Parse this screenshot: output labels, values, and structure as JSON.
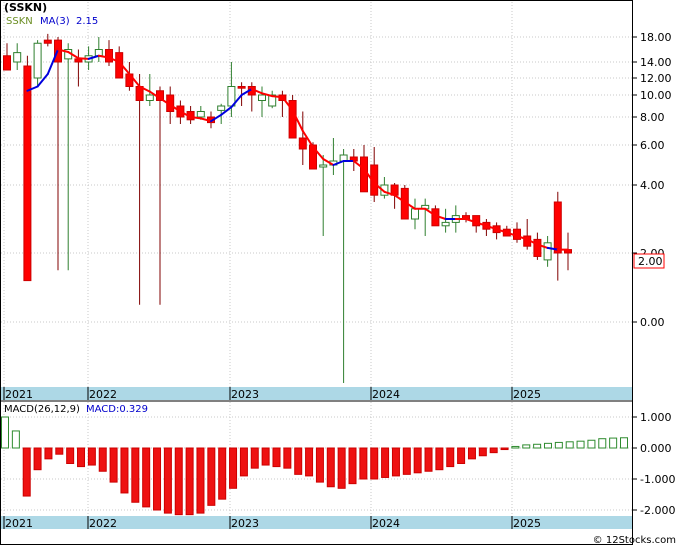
{
  "header": {
    "symbol": "(SSKN)",
    "ma_label": "MA(3)",
    "ma_value": "2.15",
    "last_price_tag": "2.00"
  },
  "macd_panel": {
    "label": "MACD(26,12,9)",
    "value_label": "MACD:0.329"
  },
  "watermark": "© 12Stocks.com",
  "colors": {
    "up_candle": "#3a9a3a",
    "down_candle": "#ff0000",
    "ma_up": "#0000dd",
    "ma_down": "#ff0000",
    "macd_up": "#2e8b2e",
    "macd_down": "#ee1111",
    "time_axis_band": "#add8e6",
    "price_tag": "#ff0000"
  },
  "chart_data": [
    {
      "type": "candlestick",
      "title": "(SSKN)",
      "y_scale": "custom-log",
      "y_ticks": [
        "18.00",
        "14.00",
        "12.00",
        "10.00",
        "8.00",
        "6.00",
        "4.00",
        "2.00",
        "0.00"
      ],
      "x_tick_labels": [
        "2021",
        "2022",
        "2023",
        "2024",
        "2025"
      ],
      "candles": [
        {
          "o": 15.0,
          "h": 17.0,
          "l": 13.5,
          "c": 13.0
        },
        {
          "o": 14.0,
          "h": 17.0,
          "l": 13.0,
          "c": 15.5
        },
        {
          "o": 13.5,
          "h": 15.0,
          "l": 1.2,
          "c": 1.2
        },
        {
          "o": 12.0,
          "h": 17.5,
          "l": 11.0,
          "c": 17.0
        },
        {
          "o": 17.5,
          "h": 18.5,
          "l": 16.5,
          "c": 17.0
        },
        {
          "o": 17.5,
          "h": 18.0,
          "l": 1.5,
          "c": 14.0
        },
        {
          "o": 14.5,
          "h": 17.0,
          "l": 1.5,
          "c": 16.0
        },
        {
          "o": 14.5,
          "h": 16.0,
          "l": 11.0,
          "c": 14.0
        },
        {
          "o": 14.0,
          "h": 16.5,
          "l": 13.0,
          "c": 15.0
        },
        {
          "o": 15.0,
          "h": 18.0,
          "l": 14.0,
          "c": 16.0
        },
        {
          "o": 16.0,
          "h": 17.5,
          "l": 13.5,
          "c": 14.0
        },
        {
          "o": 15.5,
          "h": 16.5,
          "l": 12.0,
          "c": 12.0
        },
        {
          "o": 12.5,
          "h": 14.0,
          "l": 10.5,
          "c": 11.0
        },
        {
          "o": 11.0,
          "h": 12.5,
          "l": 0.5,
          "c": 9.5
        },
        {
          "o": 9.5,
          "h": 12.5,
          "l": 9.0,
          "c": 10.0
        },
        {
          "o": 10.5,
          "h": 11.0,
          "l": 0.5,
          "c": 9.5
        },
        {
          "o": 10.0,
          "h": 11.0,
          "l": 7.5,
          "c": 8.5
        },
        {
          "o": 9.0,
          "h": 9.5,
          "l": 7.5,
          "c": 8.0
        },
        {
          "o": 8.5,
          "h": 9.0,
          "l": 7.5,
          "c": 7.8
        },
        {
          "o": 8.0,
          "h": 9.0,
          "l": 7.8,
          "c": 8.5
        },
        {
          "o": 8.0,
          "h": 8.5,
          "l": 7.2,
          "c": 7.6
        },
        {
          "o": 8.6,
          "h": 9.2,
          "l": 7.5,
          "c": 9.0
        },
        {
          "o": 9.0,
          "h": 14.0,
          "l": 8.0,
          "c": 11.0
        },
        {
          "o": 11.0,
          "h": 11.5,
          "l": 9.0,
          "c": 10.8
        },
        {
          "o": 11.0,
          "h": 11.5,
          "l": 8.5,
          "c": 10.0
        },
        {
          "o": 9.5,
          "h": 11.0,
          "l": 8.0,
          "c": 10.0
        },
        {
          "o": 9.0,
          "h": 10.5,
          "l": 8.8,
          "c": 10.0
        },
        {
          "o": 10.0,
          "h": 10.5,
          "l": 8.0,
          "c": 9.5
        },
        {
          "o": 9.5,
          "h": 10.0,
          "l": 6.5,
          "c": 6.5
        },
        {
          "o": 6.5,
          "h": 8.5,
          "l": 5.0,
          "c": 5.8
        },
        {
          "o": 6.0,
          "h": 6.2,
          "l": 4.8,
          "c": 4.8
        },
        {
          "o": 4.9,
          "h": 5.5,
          "l": 2.5,
          "c": 5.0
        },
        {
          "o": 5.0,
          "h": 6.5,
          "l": 4.5,
          "c": 5.2
        },
        {
          "o": 5.2,
          "h": 5.8,
          "l": -1.5,
          "c": 5.5
        },
        {
          "o": 5.4,
          "h": 5.8,
          "l": 4.7,
          "c": 5.2
        },
        {
          "o": 5.4,
          "h": 6.0,
          "l": 4.0,
          "c": 3.8
        },
        {
          "o": 5.0,
          "h": 5.9,
          "l": 3.5,
          "c": 3.7
        },
        {
          "o": 3.7,
          "h": 4.4,
          "l": 3.6,
          "c": 4.0
        },
        {
          "o": 4.0,
          "h": 4.1,
          "l": 3.3,
          "c": 3.7
        },
        {
          "o": 3.9,
          "h": 4.0,
          "l": 3.0,
          "c": 3.0
        },
        {
          "o": 3.0,
          "h": 3.6,
          "l": 2.7,
          "c": 3.3
        },
        {
          "o": 3.3,
          "h": 3.6,
          "l": 2.5,
          "c": 3.4
        },
        {
          "o": 3.3,
          "h": 3.4,
          "l": 2.8,
          "c": 2.8
        },
        {
          "o": 2.8,
          "h": 3.3,
          "l": 2.6,
          "c": 2.9
        },
        {
          "o": 2.9,
          "h": 3.4,
          "l": 2.6,
          "c": 3.1
        },
        {
          "o": 3.1,
          "h": 3.2,
          "l": 2.9,
          "c": 3.0
        },
        {
          "o": 3.1,
          "h": 3.1,
          "l": 2.6,
          "c": 2.8
        },
        {
          "o": 2.9,
          "h": 3.0,
          "l": 2.5,
          "c": 2.7
        },
        {
          "o": 2.8,
          "h": 2.9,
          "l": 2.4,
          "c": 2.6
        },
        {
          "o": 2.7,
          "h": 2.8,
          "l": 2.5,
          "c": 2.5
        },
        {
          "o": 2.7,
          "h": 2.9,
          "l": 2.3,
          "c": 2.4
        },
        {
          "o": 2.5,
          "h": 3.0,
          "l": 2.1,
          "c": 2.2
        },
        {
          "o": 2.4,
          "h": 2.6,
          "l": 1.8,
          "c": 1.9
        },
        {
          "o": 1.8,
          "h": 2.5,
          "l": 1.6,
          "c": 2.3
        },
        {
          "o": 3.5,
          "h": 3.8,
          "l": 1.2,
          "c": 2.0
        },
        {
          "o": 2.1,
          "h": 2.6,
          "l": 1.5,
          "c": 2.0
        }
      ],
      "ma3": [
        null,
        null,
        10.5,
        11.0,
        12.5,
        16.0,
        15.6,
        14.6,
        14.5,
        15.0,
        14.7,
        14.0,
        12.5,
        11.0,
        10.4,
        9.7,
        9.1,
        8.5,
        8.0,
        7.9,
        7.7,
        8.2,
        8.9,
        10.0,
        10.7,
        10.2,
        9.9,
        9.8,
        8.6,
        7.0,
        5.9,
        5.3,
        5.0,
        5.2,
        5.2,
        4.8,
        4.1,
        3.8,
        3.7,
        3.5,
        3.3,
        3.3,
        3.1,
        3.0,
        3.0,
        3.0,
        2.9,
        2.8,
        2.7,
        2.6,
        2.5,
        2.4,
        2.25,
        2.15,
        2.1,
        2.1
      ],
      "ma3_trend_up": [
        null,
        null,
        true,
        true,
        true,
        true,
        false,
        false,
        false,
        true,
        false,
        false,
        false,
        false,
        false,
        false,
        false,
        false,
        false,
        false,
        false,
        true,
        true,
        true,
        true,
        false,
        false,
        false,
        false,
        false,
        false,
        false,
        false,
        true,
        true,
        false,
        false,
        false,
        false,
        false,
        false,
        false,
        false,
        false,
        true,
        false,
        false,
        false,
        false,
        false,
        false,
        false,
        false,
        false,
        true,
        false
      ]
    },
    {
      "type": "bar",
      "title": "MACD(26,12,9)",
      "y_ticks": [
        "1.000",
        "0.000",
        "-1.000",
        "-2.000"
      ],
      "x_tick_labels": [
        "2021",
        "2022",
        "2023",
        "2024",
        "2025"
      ],
      "values": [
        1.0,
        0.55,
        -1.55,
        -0.7,
        -0.35,
        -0.2,
        -0.5,
        -0.6,
        -0.55,
        -0.75,
        -1.1,
        -1.45,
        -1.75,
        -1.9,
        -2.0,
        -2.1,
        -2.15,
        -2.15,
        -2.1,
        -1.85,
        -1.65,
        -1.3,
        -0.9,
        -0.65,
        -0.55,
        -0.6,
        -0.65,
        -0.85,
        -0.9,
        -1.1,
        -1.25,
        -1.3,
        -1.15,
        -1.0,
        -1.0,
        -0.95,
        -0.9,
        -0.85,
        -0.8,
        -0.75,
        -0.7,
        -0.6,
        -0.5,
        -0.35,
        -0.25,
        -0.15,
        -0.05,
        0.05,
        0.1,
        0.12,
        0.15,
        0.18,
        0.2,
        0.22,
        0.25,
        0.3,
        0.32,
        0.33
      ]
    }
  ]
}
